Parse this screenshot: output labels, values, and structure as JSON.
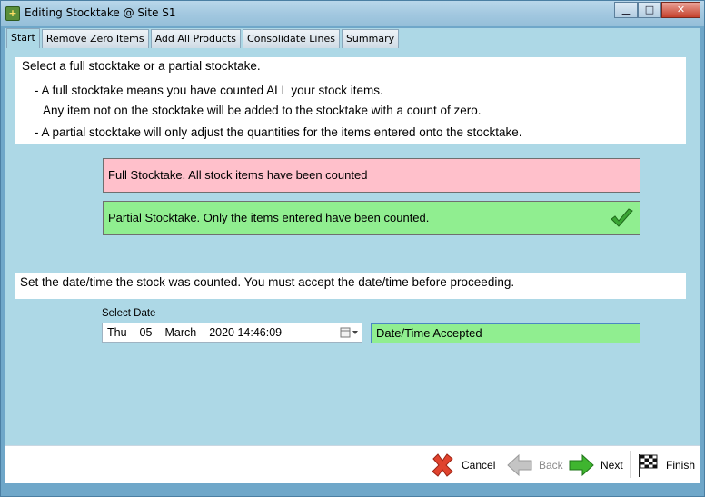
{
  "window": {
    "title": "Editing Stocktake @ Site S1",
    "controls": {
      "minimize": "▁",
      "maximize": "□",
      "close": "✕"
    }
  },
  "tabs": [
    {
      "label": "Start",
      "active": true
    },
    {
      "label": "Remove Zero Items",
      "active": false
    },
    {
      "label": "Add All Products",
      "active": false
    },
    {
      "label": "Consolidate Lines",
      "active": false
    },
    {
      "label": "Summary",
      "active": false
    }
  ],
  "instructions": {
    "heading": "Select a full stocktake or a partial stocktake.",
    "line1": "- A full stocktake means you have counted ALL your stock items.",
    "line2": "Any item not on the stocktake will be added to the stocktake with a count of zero.",
    "line3": "- A partial stocktake will only adjust the quantities for the items entered onto the stocktake."
  },
  "options": {
    "full": {
      "label": "Full Stocktake.  All stock items have been counted",
      "color": "#ffc0cb",
      "selected": false
    },
    "partial": {
      "label": "Partial Stocktake.  Only the items entered have been counted.",
      "color": "#90ee90",
      "selected": true,
      "icon": "checkmark-icon"
    }
  },
  "date_section": {
    "instruction": "Set the date/time the stock was counted.  You must accept the date/time before proceeding.",
    "select_label": "Select Date",
    "date_day": "Thu",
    "date_num": "05",
    "date_month": "March",
    "date_rest": "2020 14:46:09",
    "accepted_text": "Date/Time Accepted",
    "accepted_color": "#90ee90"
  },
  "footer": {
    "cancel": {
      "label": "Cancel",
      "icon": "red-x-icon",
      "enabled": true
    },
    "back": {
      "label": "Back",
      "icon": "back-arrow-icon",
      "enabled": false
    },
    "next": {
      "label": "Next",
      "icon": "next-arrow-icon",
      "enabled": true
    },
    "finish": {
      "label": "Finish",
      "icon": "checkered-flag-icon",
      "enabled": true
    }
  },
  "colors": {
    "background": "#add8e6",
    "frame": "#6fa7c9"
  }
}
